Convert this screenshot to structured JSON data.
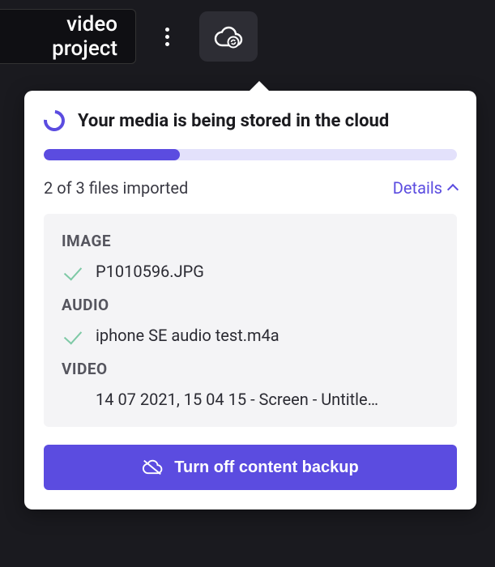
{
  "topbar": {
    "project_tab_label": "video project"
  },
  "popover": {
    "title": "Your media is being stored in the cloud",
    "progress_percent": 33,
    "status_text": "2 of 3 files imported",
    "details_label": "Details",
    "categories": [
      {
        "label": "IMAGE",
        "items": [
          {
            "name": "P1010596.JPG",
            "done": true
          }
        ]
      },
      {
        "label": "AUDIO",
        "items": [
          {
            "name": "iphone SE audio test.m4a",
            "done": true
          }
        ]
      },
      {
        "label": "VIDEO",
        "items": [
          {
            "name": "14 07 2021, 15 04 15 - Screen - Untitle…",
            "done": false
          }
        ]
      }
    ],
    "turnoff_label": "Turn off content backup"
  }
}
